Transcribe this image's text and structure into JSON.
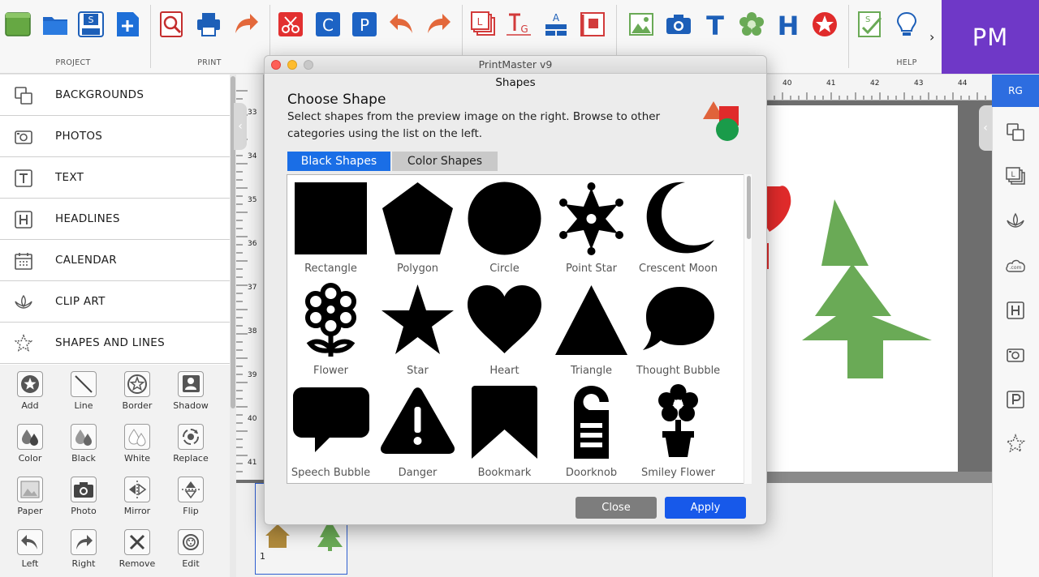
{
  "toolbar": {
    "groups": [
      {
        "label": "PROJECT"
      },
      {
        "label": "PRINT"
      },
      {
        "label": "HELP"
      }
    ],
    "more_glyph": "›",
    "app_badge": "PM"
  },
  "left_panel": {
    "categories": [
      {
        "label": "BACKGROUNDS",
        "icon": "backgrounds-icon"
      },
      {
        "label": "PHOTOS",
        "icon": "photos-icon"
      },
      {
        "label": "TEXT",
        "icon": "text-icon"
      },
      {
        "label": "HEADLINES",
        "icon": "headlines-icon"
      },
      {
        "label": "CALENDAR",
        "icon": "calendar-icon"
      },
      {
        "label": "CLIP ART",
        "icon": "lotus-icon"
      },
      {
        "label": "SHAPES AND LINES",
        "icon": "star-outline-icon"
      }
    ],
    "tools": [
      {
        "label": "Add",
        "icon": "add-star-icon"
      },
      {
        "label": "Line",
        "icon": "line-icon"
      },
      {
        "label": "Border",
        "icon": "border-icon"
      },
      {
        "label": "Shadow",
        "icon": "shadow-icon"
      },
      {
        "label": "Color",
        "icon": "color-drops-icon"
      },
      {
        "label": "Black",
        "icon": "black-drops-icon"
      },
      {
        "label": "White",
        "icon": "white-drops-icon"
      },
      {
        "label": "Replace",
        "icon": "replace-icon"
      },
      {
        "label": "Paper",
        "icon": "paper-icon"
      },
      {
        "label": "Photo",
        "icon": "photo-camera-icon"
      },
      {
        "label": "Mirror",
        "icon": "mirror-icon"
      },
      {
        "label": "Flip",
        "icon": "flip-icon"
      },
      {
        "label": "Left",
        "icon": "rotate-left-icon"
      },
      {
        "label": "Right",
        "icon": "rotate-right-icon"
      },
      {
        "label": "Remove",
        "icon": "remove-icon"
      },
      {
        "label": "Edit",
        "icon": "edit-icon"
      }
    ]
  },
  "rulers": {
    "top": [
      "40",
      "41",
      "42",
      "43",
      "44"
    ],
    "left": [
      "33",
      "34",
      "35",
      "36",
      "37",
      "38",
      "39",
      "40",
      "41"
    ]
  },
  "right_panel": {
    "tab_label": "RG"
  },
  "filmstrip": {
    "page_number": "1"
  },
  "dialog": {
    "window_title": "PrintMaster v9",
    "subtitle": "Shapes",
    "heading": "Choose Shape",
    "description": "Select shapes from the preview image on the right. Browse to other categories using the list on the left.",
    "tabs": [
      {
        "label": "Black Shapes",
        "active": true
      },
      {
        "label": "Color Shapes",
        "active": false
      }
    ],
    "shapes": [
      {
        "label": "Rectangle"
      },
      {
        "label": "Polygon"
      },
      {
        "label": "Circle"
      },
      {
        "label": "Point Star"
      },
      {
        "label": "Crescent Moon"
      },
      {
        "label": "Flower"
      },
      {
        "label": "Star"
      },
      {
        "label": "Heart"
      },
      {
        "label": "Triangle"
      },
      {
        "label": "Thought Bubble"
      },
      {
        "label": "Speech Bubble"
      },
      {
        "label": "Danger"
      },
      {
        "label": "Bookmark"
      },
      {
        "label": "Doorknob"
      },
      {
        "label": "Smiley Flower"
      }
    ],
    "buttons": {
      "close": "Close",
      "apply": "Apply"
    }
  },
  "colors": {
    "accent_blue": "#1a6ee6",
    "badge_purple": "#6f38c7",
    "tree_green": "#6aaa56",
    "heart_red": "#e02b2b"
  }
}
